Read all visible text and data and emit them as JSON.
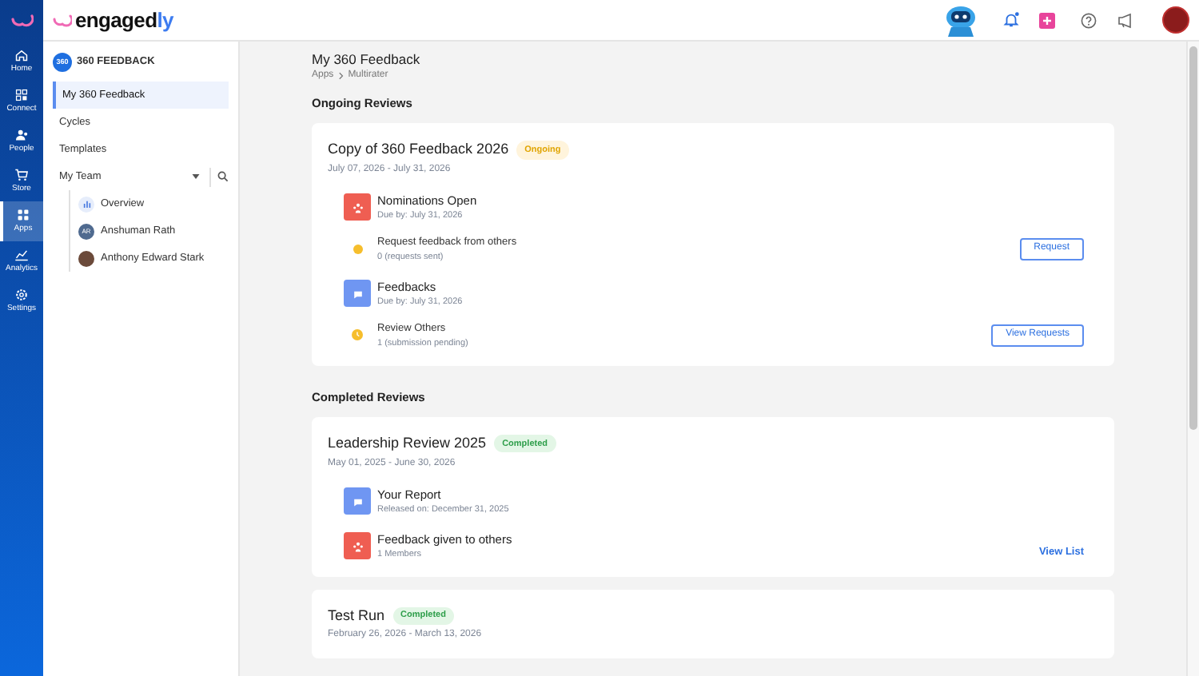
{
  "logo": {
    "parts": [
      "engaged",
      "ly"
    ]
  },
  "rail": [
    {
      "label": "Home",
      "selected": false
    },
    {
      "label": "Connect",
      "selected": false
    },
    {
      "label": "People",
      "selected": false
    },
    {
      "label": "Store",
      "selected": false
    },
    {
      "label": "Apps",
      "selected": true
    },
    {
      "label": "Analytics",
      "selected": false
    },
    {
      "label": "Settings",
      "selected": false
    }
  ],
  "sidebar": {
    "module": {
      "badge": "360",
      "title": "360 FEEDBACK"
    },
    "items": [
      {
        "label": "My 360 Feedback",
        "selected": true
      },
      {
        "label": "Cycles",
        "selected": false
      },
      {
        "label": "Templates",
        "selected": false
      },
      {
        "label": "My Team",
        "selected": false,
        "expanded": true,
        "children": [
          {
            "label": "Overview",
            "kind": "chart"
          },
          {
            "label": "Anshuman Rath",
            "kind": "initials",
            "initials": "AR"
          },
          {
            "label": "Anthony Edward Stark",
            "kind": "photo"
          }
        ]
      }
    ]
  },
  "page": {
    "title": "My 360 Feedback",
    "breadcrumb": [
      "Apps",
      "Multirater"
    ]
  },
  "sections": [
    {
      "heading": "Ongoing Reviews",
      "cards": [
        {
          "title": "Copy of 360 Feedback 2026",
          "status": {
            "label": "Ongoing",
            "kind": "ongoing"
          },
          "dates": "July 07, 2026 - July 31, 2026",
          "items": [
            {
              "kind": "nominations",
              "title": "Nominations Open",
              "sub": "Due by: July 31, 2026"
            },
            {
              "kind": "request",
              "title": "Request feedback from others",
              "sub": "0 (requests sent)",
              "action": {
                "label": "Request",
                "kind": "outline"
              }
            },
            {
              "kind": "feedback",
              "title": "Feedbacks",
              "sub": "Due by: July 31, 2026"
            },
            {
              "kind": "pending",
              "title": "Review Others",
              "sub": "1 (submission pending)",
              "action": {
                "label": "View Requests",
                "kind": "outline"
              }
            }
          ]
        }
      ]
    },
    {
      "heading": "Completed Reviews",
      "cards": [
        {
          "title": "Leadership Review 2025",
          "status": {
            "label": "Completed",
            "kind": "completed"
          },
          "dates": "May 01, 2025 - June 30, 2026",
          "items": [
            {
              "kind": "feedback",
              "title": "Your Report",
              "sub": "Released on: December 31, 2025"
            },
            {
              "kind": "nominations",
              "title": "Feedback given to others",
              "sub": "1 Members",
              "action": {
                "label": "View List",
                "kind": "link"
              }
            }
          ]
        },
        {
          "title": "Test Run",
          "status": {
            "label": "Completed",
            "kind": "completed"
          },
          "dates": "February 26, 2026 - March 13, 2026"
        }
      ]
    }
  ]
}
